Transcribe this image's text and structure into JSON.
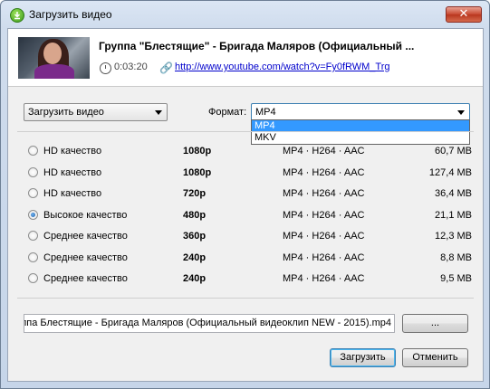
{
  "window": {
    "title": "Загрузить видео",
    "close_label": "✕"
  },
  "video": {
    "title": "Группа \"Блестящие\" - Бригада Маляров (Официальный ...",
    "duration": "0:03:20",
    "url": "http://www.youtube.com/watch?v=Fy0fRWM_Trg"
  },
  "action_combo": {
    "value": "Загрузить видео"
  },
  "format": {
    "label": "Формат:",
    "value": "MP4",
    "options": [
      "MP4",
      "MKV"
    ]
  },
  "qualities": [
    {
      "label": "HD качество",
      "resolution": "1080p",
      "codec": "MP4 · H264 · AAC",
      "size": "60,7 MB",
      "selected": false
    },
    {
      "label": "HD качество",
      "resolution": "1080p",
      "codec": "MP4 · H264 · AAC",
      "size": "127,4 MB",
      "selected": false
    },
    {
      "label": "HD качество",
      "resolution": "720p",
      "codec": "MP4 · H264 · AAC",
      "size": "36,4 MB",
      "selected": false
    },
    {
      "label": "Высокое качество",
      "resolution": "480p",
      "codec": "MP4 · H264 · AAC",
      "size": "21,1 MB",
      "selected": true
    },
    {
      "label": "Среднее качество",
      "resolution": "360p",
      "codec": "MP4 · H264 · AAC",
      "size": "12,3 MB",
      "selected": false
    },
    {
      "label": "Среднее качество",
      "resolution": "240p",
      "codec": "MP4 · H264 · AAC",
      "size": "8,8 MB",
      "selected": false
    },
    {
      "label": "Среднее качество",
      "resolution": "240p",
      "codec": "MP4 · H264 · AAC",
      "size": "9,5 MB",
      "selected": false
    }
  ],
  "save_path": {
    "value": "ппа  Блестящие  - Бригада Маляров (Официальный видеоклип NEW - 2015).mp4"
  },
  "buttons": {
    "browse": "...",
    "download": "Загрузить",
    "cancel": "Отменить"
  }
}
